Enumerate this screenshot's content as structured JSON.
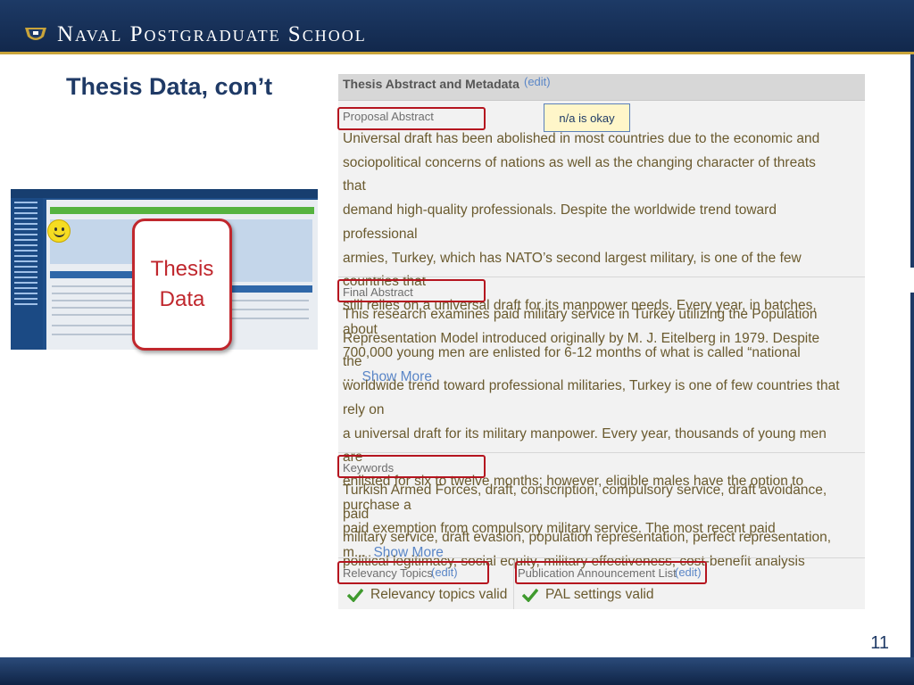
{
  "header": {
    "school_name": "Naval Postgraduate School"
  },
  "slide": {
    "title": "Thesis Data, con’t",
    "number": "11"
  },
  "thumbnail_callout": {
    "label": "Thesis\nData"
  },
  "callout": {
    "text": "n/a is okay"
  },
  "panel": {
    "title": "Thesis Abstract and Metadata",
    "edit_label": "(edit)",
    "proposal": {
      "label": "Proposal Abstract",
      "lines": [
        "Universal draft has been abolished in most countries due to the economic and",
        "sociopolitical concerns of nations as well as the changing character of threats that",
        "demand high-quality professionals. Despite the worldwide trend toward professional",
        "armies, Turkey, which has NATO’s second largest military, is one of the few countries that",
        "still relies on a universal draft for its manpower needs. Every year, in batches, about",
        "700,000 young men are enlisted for 6-12 months of what is called “national ..."
      ],
      "show_more": "Show More"
    },
    "final": {
      "label": "Final Abstract",
      "lines": [
        "This research examines paid military service in Turkey utilizing the Population",
        "Representation Model introduced originally by M. J. Eitelberg in 1979. Despite the",
        "worldwide trend toward professional militaries, Turkey is one of few countries that rely on",
        "a universal draft for its military manpower. Every year, thousands of young men are",
        "enlisted for six to twelve months; however, eligible males have the option to purchase a",
        "paid exemption from compulsory military service. The most recent paid m..."
      ],
      "show_more": "Show More"
    },
    "keywords": {
      "label": "Keywords",
      "lines": [
        "Turkish Armed Forces, draft, conscription, compulsory service, draft avoidance, paid",
        "military service, draft evasion, population representation, perfect representation,",
        "political legitimacy, social equity, military effectiveness, cost-benefit analysis"
      ]
    },
    "relevancy": {
      "label": "Relevancy Topics",
      "edit_label": "(edit)",
      "status": "Relevancy topics valid"
    },
    "pal": {
      "label": "Publication Announcement List",
      "edit_label": "(edit)",
      "status": "PAL settings valid"
    }
  },
  "colors": {
    "navy": "#1f3a66",
    "gold": "#c9a43a",
    "highlight_red": "#b5151f",
    "link_blue": "#5a86c7",
    "check_green": "#3f9a2e"
  }
}
